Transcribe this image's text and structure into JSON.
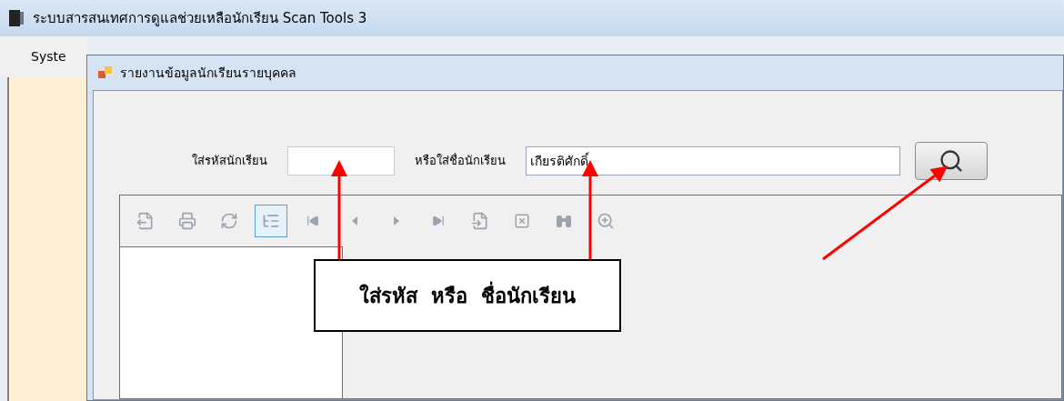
{
  "window": {
    "title": "ระบบสารสนเทศการดูแลช่วยเหลือนักเรียน Scan Tools 3"
  },
  "menu": [
    "Syste"
  ],
  "child_window": {
    "title": "รายงานข้อมูลนักเรียนรายบุคคล"
  },
  "search": {
    "id_label": "ใส่รหัสนักเรียน",
    "name_label": "หรือใส่ชื่อนักเรียน",
    "name_value": "เกียรติศักดิ์"
  },
  "toolbar": [
    {
      "selected": false
    },
    {
      "selected": false
    },
    {
      "selected": false
    },
    {
      "selected": true
    },
    {
      "selected": false
    },
    {
      "selected": false
    },
    {
      "selected": false
    },
    {
      "selected": false
    },
    {
      "selected": false
    },
    {
      "selected": false
    },
    {
      "selected": false
    },
    {
      "selected": false
    }
  ],
  "annotation": {
    "text": "ใส่รหัส  หรือ  ชื่อนักเรียน"
  }
}
